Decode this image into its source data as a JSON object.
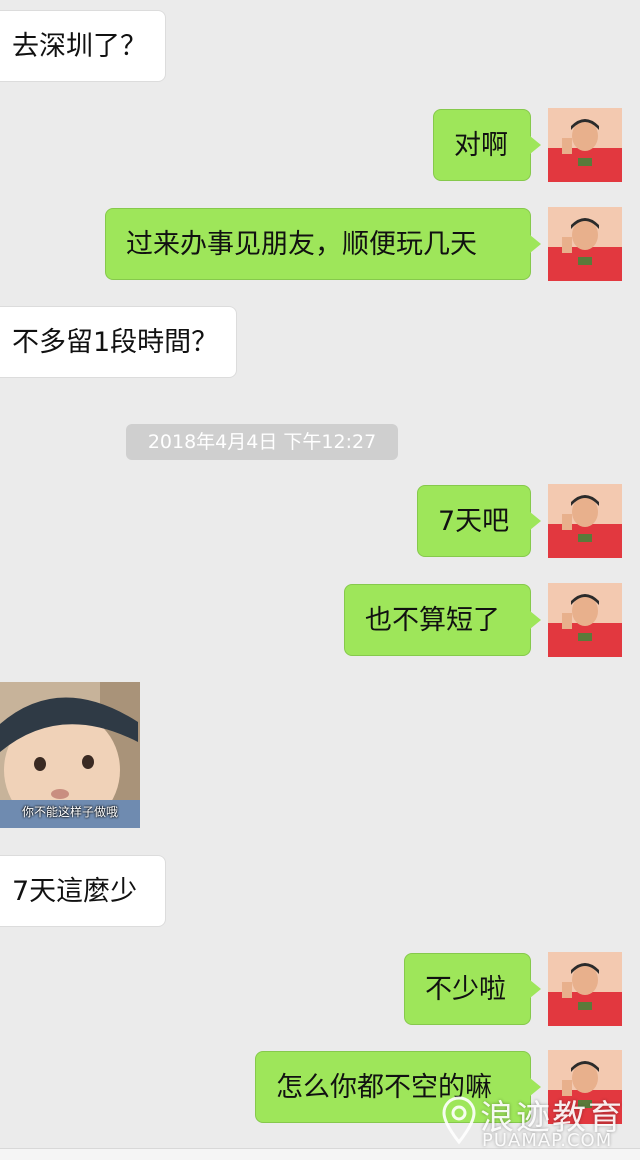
{
  "messages": [
    {
      "side": "in",
      "text": "去深圳了？"
    },
    {
      "side": "out",
      "text": "对啊"
    },
    {
      "side": "out",
      "text": "过来办事见朋友，顺便玩几天"
    },
    {
      "side": "in",
      "text": "不多留1段時間？"
    },
    {
      "side": "out",
      "text": "7天吧"
    },
    {
      "side": "out",
      "text": "也不算短了"
    },
    {
      "side": "in",
      "text": "7天這麼少"
    },
    {
      "side": "out",
      "text": "不少啦"
    },
    {
      "side": "out",
      "text": "怎么你都不空的嘛"
    }
  ],
  "timestamp": "2018年4月4日 下午12:27",
  "sticker": {
    "caption": "你不能这样子做哦"
  },
  "watermark": {
    "brand": "浪迹教育",
    "domain": "PUAMAP.COM"
  },
  "colors": {
    "background": "#ebebeb",
    "outgoing_bubble": "#9ee65a",
    "incoming_bubble": "#ffffff",
    "timestamp_pill": "#cfcfcf"
  }
}
